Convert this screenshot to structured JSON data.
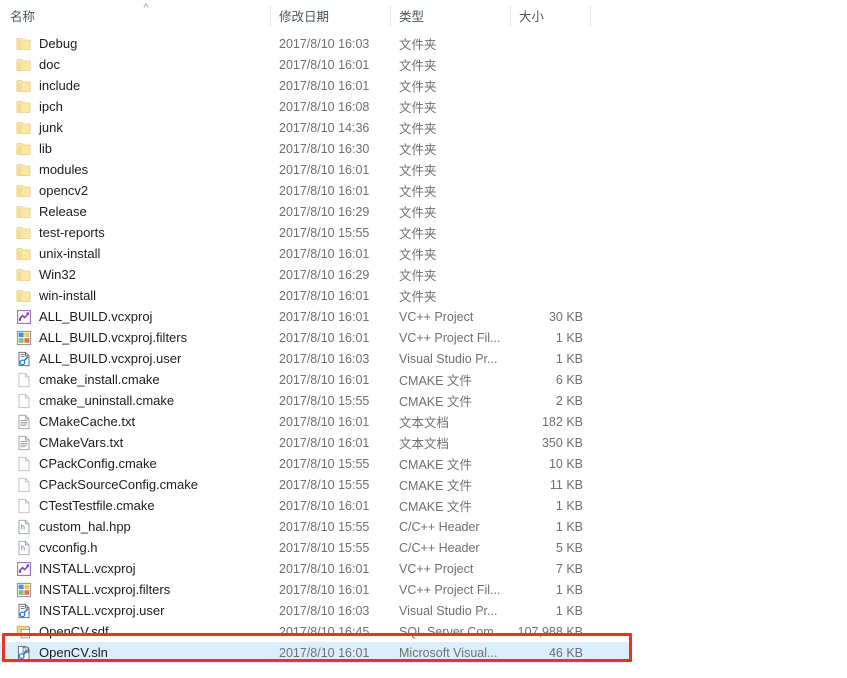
{
  "header": {
    "columns": [
      {
        "id": "name",
        "label": "名称"
      },
      {
        "id": "date",
        "label": "修改日期"
      },
      {
        "id": "type",
        "label": "类型"
      },
      {
        "id": "size",
        "label": "大小"
      }
    ],
    "sort": {
      "column": "名称",
      "direction": "ascending",
      "caret_glyph": "^"
    }
  },
  "annotation": {
    "highlight_color": "#ee3124",
    "selected_row_color": "#dbeefd",
    "target_row_name": "OpenCV.sln"
  },
  "rows": [
    {
      "name": "Debug",
      "icon": "folder-icon",
      "date": "2017/8/10 16:03",
      "type": "文件夹",
      "size": "",
      "selected": false
    },
    {
      "name": "doc",
      "icon": "folder-icon",
      "date": "2017/8/10 16:01",
      "type": "文件夹",
      "size": "",
      "selected": false
    },
    {
      "name": "include",
      "icon": "folder-icon",
      "date": "2017/8/10 16:01",
      "type": "文件夹",
      "size": "",
      "selected": false
    },
    {
      "name": "ipch",
      "icon": "folder-icon",
      "date": "2017/8/10 16:08",
      "type": "文件夹",
      "size": "",
      "selected": false
    },
    {
      "name": "junk",
      "icon": "folder-icon",
      "date": "2017/8/10 14:36",
      "type": "文件夹",
      "size": "",
      "selected": false
    },
    {
      "name": "lib",
      "icon": "folder-icon",
      "date": "2017/8/10 16:30",
      "type": "文件夹",
      "size": "",
      "selected": false
    },
    {
      "name": "modules",
      "icon": "folder-icon",
      "date": "2017/8/10 16:01",
      "type": "文件夹",
      "size": "",
      "selected": false
    },
    {
      "name": "opencv2",
      "icon": "folder-icon",
      "date": "2017/8/10 16:01",
      "type": "文件夹",
      "size": "",
      "selected": false
    },
    {
      "name": "Release",
      "icon": "folder-icon",
      "date": "2017/8/10 16:29",
      "type": "文件夹",
      "size": "",
      "selected": false
    },
    {
      "name": "test-reports",
      "icon": "folder-icon",
      "date": "2017/8/10 15:55",
      "type": "文件夹",
      "size": "",
      "selected": false
    },
    {
      "name": "unix-install",
      "icon": "folder-icon",
      "date": "2017/8/10 16:01",
      "type": "文件夹",
      "size": "",
      "selected": false
    },
    {
      "name": "Win32",
      "icon": "folder-icon",
      "date": "2017/8/10 16:29",
      "type": "文件夹",
      "size": "",
      "selected": false
    },
    {
      "name": "win-install",
      "icon": "folder-icon",
      "date": "2017/8/10 16:01",
      "type": "文件夹",
      "size": "",
      "selected": false
    },
    {
      "name": "ALL_BUILD.vcxproj",
      "icon": "vcxproj-icon",
      "date": "2017/8/10 16:01",
      "type": "VC++ Project",
      "size": "30 KB",
      "selected": false
    },
    {
      "name": "ALL_BUILD.vcxproj.filters",
      "icon": "vcxproj-filters-icon",
      "date": "2017/8/10 16:01",
      "type": "VC++ Project Fil...",
      "size": "1 KB",
      "selected": false
    },
    {
      "name": "ALL_BUILD.vcxproj.user",
      "icon": "vcxproj-user-icon",
      "date": "2017/8/10 16:03",
      "type": "Visual Studio Pr...",
      "size": "1 KB",
      "selected": false
    },
    {
      "name": "cmake_install.cmake",
      "icon": "blank-document-icon",
      "date": "2017/8/10 16:01",
      "type": "CMAKE 文件",
      "size": "6 KB",
      "selected": false
    },
    {
      "name": "cmake_uninstall.cmake",
      "icon": "blank-document-icon",
      "date": "2017/8/10 15:55",
      "type": "CMAKE 文件",
      "size": "2 KB",
      "selected": false
    },
    {
      "name": "CMakeCache.txt",
      "icon": "text-document-icon",
      "date": "2017/8/10 16:01",
      "type": "文本文档",
      "size": "182 KB",
      "selected": false
    },
    {
      "name": "CMakeVars.txt",
      "icon": "text-document-icon",
      "date": "2017/8/10 16:01",
      "type": "文本文档",
      "size": "350 KB",
      "selected": false
    },
    {
      "name": "CPackConfig.cmake",
      "icon": "blank-document-icon",
      "date": "2017/8/10 15:55",
      "type": "CMAKE 文件",
      "size": "10 KB",
      "selected": false
    },
    {
      "name": "CPackSourceConfig.cmake",
      "icon": "blank-document-icon",
      "date": "2017/8/10 15:55",
      "type": "CMAKE 文件",
      "size": "11 KB",
      "selected": false
    },
    {
      "name": "CTestTestfile.cmake",
      "icon": "blank-document-icon",
      "date": "2017/8/10 16:01",
      "type": "CMAKE 文件",
      "size": "1 KB",
      "selected": false
    },
    {
      "name": "custom_hal.hpp",
      "icon": "header-file-icon",
      "date": "2017/8/10 15:55",
      "type": "C/C++ Header",
      "size": "1 KB",
      "selected": false
    },
    {
      "name": "cvconfig.h",
      "icon": "header-file-icon",
      "date": "2017/8/10 15:55",
      "type": "C/C++ Header",
      "size": "5 KB",
      "selected": false
    },
    {
      "name": "INSTALL.vcxproj",
      "icon": "vcxproj-icon",
      "date": "2017/8/10 16:01",
      "type": "VC++ Project",
      "size": "7 KB",
      "selected": false
    },
    {
      "name": "INSTALL.vcxproj.filters",
      "icon": "vcxproj-filters-icon",
      "date": "2017/8/10 16:01",
      "type": "VC++ Project Fil...",
      "size": "1 KB",
      "selected": false
    },
    {
      "name": "INSTALL.vcxproj.user",
      "icon": "vcxproj-user-icon",
      "date": "2017/8/10 16:03",
      "type": "Visual Studio Pr...",
      "size": "1 KB",
      "selected": false
    },
    {
      "name": "OpenCV.sdf",
      "icon": "sdf-icon",
      "date": "2017/8/10 16:45",
      "type": "SQL Server Com...",
      "size": "107,988 KB",
      "selected": false
    },
    {
      "name": "OpenCV.sln",
      "icon": "sln-icon",
      "date": "2017/8/10 16:01",
      "type": "Microsoft Visual...",
      "size": "46 KB",
      "selected": true
    }
  ]
}
